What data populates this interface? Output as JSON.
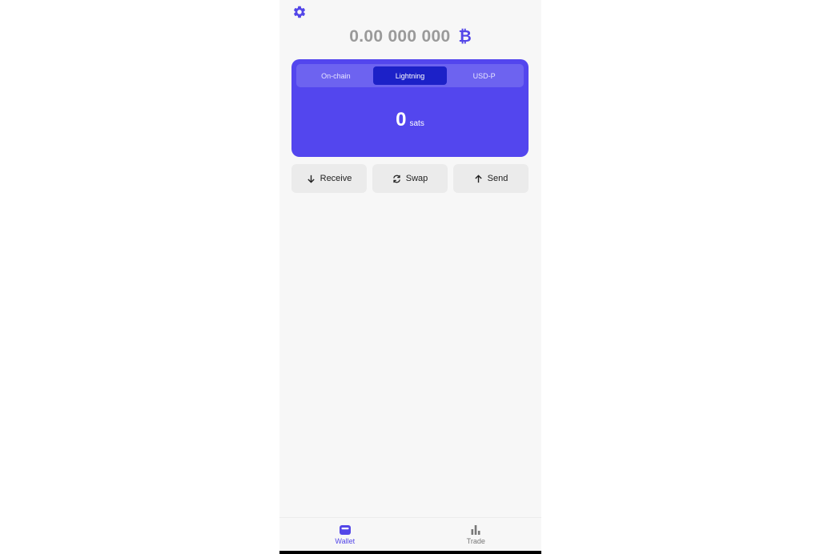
{
  "header": {
    "settings_icon": "gear-icon",
    "balance": "0.00 000 000",
    "currency_symbol": "₿"
  },
  "card": {
    "tabs": [
      {
        "label": "On-chain",
        "active": false
      },
      {
        "label": "Lightning",
        "active": true
      },
      {
        "label": "USD-P",
        "active": false
      }
    ],
    "amount": "0",
    "unit": "sats"
  },
  "actions": {
    "receive": "Receive",
    "swap": "Swap",
    "send": "Send"
  },
  "nav": {
    "wallet": "Wallet",
    "trade": "Trade",
    "active": "wallet"
  },
  "colors": {
    "accent": "#5346ee",
    "active_tab": "#1c21c8",
    "balance_text": "#9a9a9a"
  }
}
